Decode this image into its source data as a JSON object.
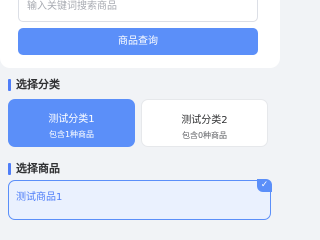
{
  "search": {
    "placeholder": "输入关键词搜索商品",
    "button_label": "商品查询"
  },
  "category_section": {
    "title": "选择分类",
    "items": [
      {
        "name": "测试分类1",
        "count_text": "包含1种商品",
        "selected": true
      },
      {
        "name": "测试分类2",
        "count_text": "包含0种商品",
        "selected": false
      }
    ]
  },
  "goods_section": {
    "title": "选择商品",
    "items": [
      {
        "name": "测试商品1",
        "selected": true,
        "check_icon": "check-icon"
      }
    ]
  },
  "colors": {
    "accent": "#5b8ff9",
    "background": "#f1f3f6",
    "selected_bg": "#eaf1fe"
  }
}
